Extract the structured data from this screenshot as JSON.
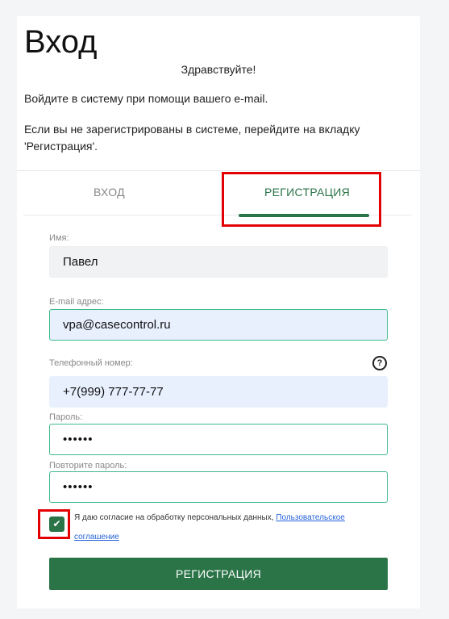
{
  "header": {
    "title": "Вход",
    "greeting": "Здравствуйте!",
    "info_line1": "Войдите в систему при помощи вашего e-mail.",
    "info_line2": "Если вы не зарегистрированы в системе, перейдите на вкладку 'Регистрация'."
  },
  "tabs": {
    "login": "ВХОД",
    "register": "РЕГИСТРАЦИЯ",
    "active": "register"
  },
  "form": {
    "name_label": "Имя:",
    "name_value": "Павел",
    "email_label": "E-mail адрес:",
    "email_value": "vpa@casecontrol.ru",
    "phone_label": "Телефонный номер:",
    "phone_value": "+7(999) 777-77-77",
    "help_icon": "question-circle-icon",
    "password_label": "Пароль:",
    "password_value": "••••••",
    "password_repeat_label": "Повторите пароль:",
    "password_repeat_value": "••••••",
    "consent_checked": true,
    "consent_text": "Я даю согласие на обработку персональных данных, ",
    "consent_link": "Пользовательское соглашение",
    "submit_label": "РЕГИСТРАЦИЯ"
  },
  "colors": {
    "accent": "#2a7447",
    "highlight": "#e30000",
    "link": "#2563d8",
    "focus_border": "#3fb98a"
  }
}
